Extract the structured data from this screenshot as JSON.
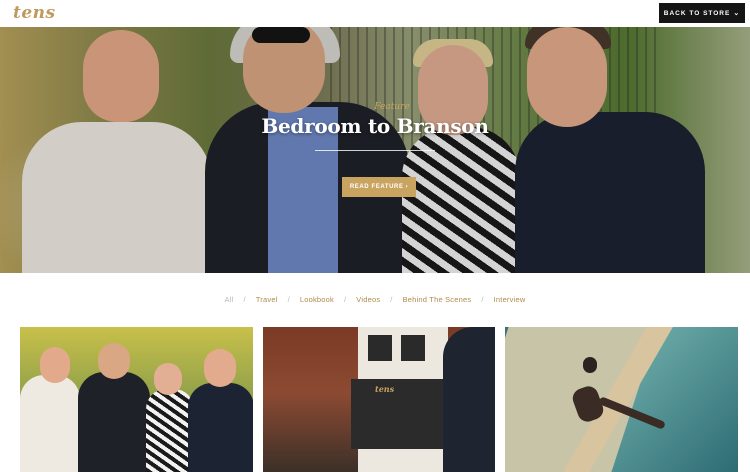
{
  "brand": {
    "logo": "tens"
  },
  "header": {
    "back_label": "BACK TO STORE",
    "back_icon": "chevron-down-icon"
  },
  "hero": {
    "kicker": "Feature",
    "title": "Bedroom to Branson",
    "cta_label": "READ FEATURE",
    "cta_icon": "chevron-right-icon"
  },
  "filters": {
    "items": [
      {
        "label": "All",
        "active": true
      },
      {
        "label": "Travel"
      },
      {
        "label": "Lookbook"
      },
      {
        "label": "Videos"
      },
      {
        "label": "Behind The Scenes"
      },
      {
        "label": "Interview"
      }
    ],
    "separator": "/"
  },
  "cards": [
    {
      "name": "card-group-photo"
    },
    {
      "name": "card-storefront",
      "sign": "tens"
    },
    {
      "name": "card-pool"
    }
  ],
  "colors": {
    "accent": "#c9a461",
    "dark": "#151515",
    "muted": "#b9b9b9"
  }
}
